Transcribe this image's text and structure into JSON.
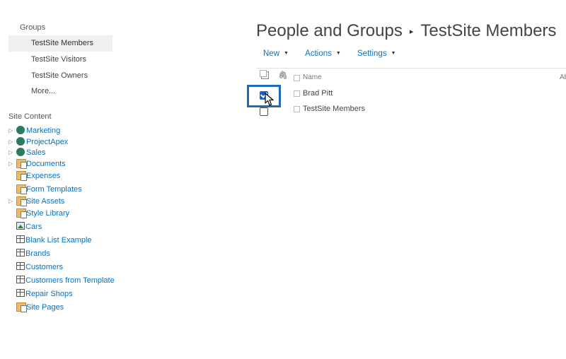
{
  "groups": {
    "heading": "Groups",
    "items": [
      {
        "label": "TestSite Members",
        "selected": true
      },
      {
        "label": "TestSite Visitors",
        "selected": false
      },
      {
        "label": "TestSite Owners",
        "selected": false
      },
      {
        "label": "More...",
        "selected": false
      }
    ]
  },
  "site_content": {
    "heading": "Site Content",
    "items": [
      {
        "label": "Marketing",
        "icon": "site-icon",
        "expandable": true
      },
      {
        "label": "ProjectApex",
        "icon": "site-icon",
        "expandable": true
      },
      {
        "label": "Sales",
        "icon": "site-icon",
        "expandable": true
      },
      {
        "label": "Documents",
        "icon": "document-library-icon",
        "expandable": true
      },
      {
        "label": "Expenses",
        "icon": "document-library-icon",
        "expandable": false
      },
      {
        "label": "Form Templates",
        "icon": "document-library-icon",
        "expandable": false
      },
      {
        "label": "Site Assets",
        "icon": "document-library-icon",
        "expandable": true
      },
      {
        "label": "Style Library",
        "icon": "document-library-icon",
        "expandable": false
      },
      {
        "label": "Cars",
        "icon": "picture-library-icon",
        "expandable": false
      },
      {
        "label": "Blank List Example",
        "icon": "list-icon",
        "expandable": false
      },
      {
        "label": "Brands",
        "icon": "list-icon",
        "expandable": false
      },
      {
        "label": "Customers",
        "icon": "list-icon",
        "expandable": false
      },
      {
        "label": "Customers from Template",
        "icon": "list-icon",
        "expandable": false
      },
      {
        "label": "Repair Shops",
        "icon": "list-icon",
        "expandable": false
      },
      {
        "label": "Site Pages",
        "icon": "document-library-icon",
        "expandable": false
      }
    ]
  },
  "header": {
    "title_left": "People and Groups",
    "separator": "▸",
    "title_right": "TestSite Members"
  },
  "toolbar": {
    "new_label": "New",
    "actions_label": "Actions",
    "settings_label": "Settings",
    "caret": "▼"
  },
  "table": {
    "columns": {
      "name": "Name",
      "about_truncated": "Ab"
    },
    "rows": [
      {
        "name": "Brad Pitt",
        "checked": true
      },
      {
        "name": "TestSite Members",
        "checked": false
      }
    ]
  },
  "colors": {
    "link": "#0072c6",
    "highlight_border": "#1e6bb8",
    "selected_nav_bg": "#efefef"
  }
}
